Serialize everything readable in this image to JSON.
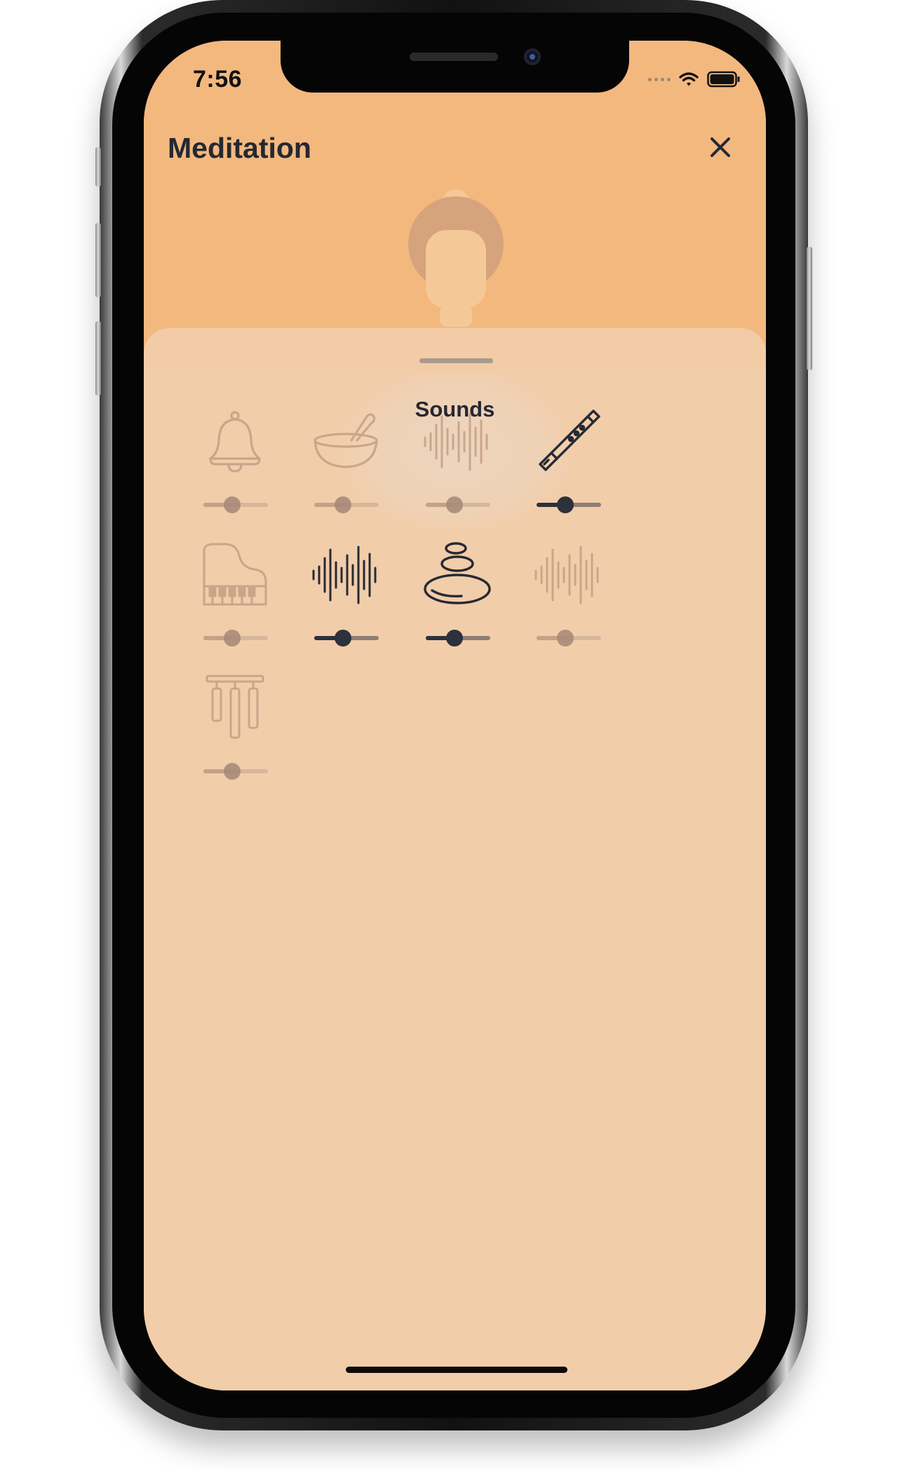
{
  "status_bar": {
    "time": "7:56"
  },
  "header": {
    "title": "Meditation",
    "close_icon": "close-icon"
  },
  "sheet": {
    "title": "Sounds"
  },
  "colors": {
    "header_bg": "#f3b87e",
    "sheet_bg": "#f2cca8",
    "active": "#262a33",
    "inactive": "#c59f84"
  },
  "sounds": [
    {
      "icon": "bell-icon",
      "active": false,
      "volume": 0.45
    },
    {
      "icon": "singing-bowl-icon",
      "active": false,
      "volume": 0.45
    },
    {
      "icon": "waveform-icon",
      "active": false,
      "volume": 0.45
    },
    {
      "icon": "flute-icon",
      "active": true,
      "volume": 0.45
    },
    {
      "icon": "piano-icon",
      "active": false,
      "volume": 0.45
    },
    {
      "icon": "waveform-icon",
      "active": true,
      "volume": 0.45
    },
    {
      "icon": "stacked-stones-icon",
      "active": true,
      "volume": 0.45
    },
    {
      "icon": "waveform-icon",
      "active": false,
      "volume": 0.45
    },
    {
      "icon": "wind-chimes-icon",
      "active": false,
      "volume": 0.45
    }
  ]
}
